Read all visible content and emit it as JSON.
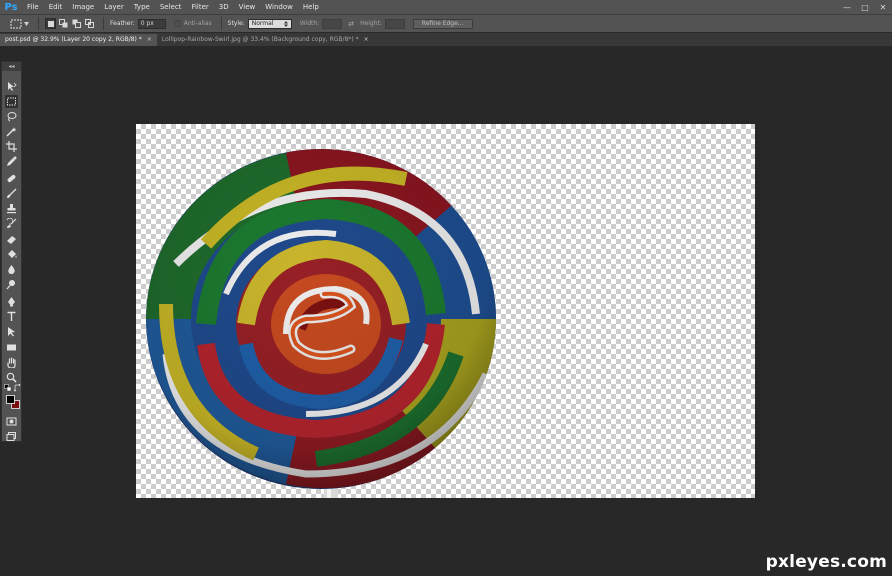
{
  "app": {
    "logo": "Ps"
  },
  "menu": [
    "File",
    "Edit",
    "Image",
    "Layer",
    "Type",
    "Select",
    "Filter",
    "3D",
    "View",
    "Window",
    "Help"
  ],
  "window_controls": {
    "minimize": "—",
    "maximize": "□",
    "close": "✕"
  },
  "options": {
    "feather_label": "Feather:",
    "feather_value": "0 px",
    "antialias_label": "Anti-alias",
    "style_label": "Style:",
    "style_value": "Normal",
    "width_label": "Width:",
    "swap_glyph": "⇄",
    "height_label": "Height:",
    "refine_edge": "Refine Edge..."
  },
  "tabs": [
    {
      "title": "post.psd @ 32.9% (Layer 20 copy 2, RGB/8) *",
      "active": true
    },
    {
      "title": "Lollipop-Rainbow-Swirl.jpg @ 33.4% (Background copy, RGB/8*) *",
      "active": false
    }
  ],
  "tab_close": "×",
  "toolbox": {
    "grip": "◂◂",
    "tools": [
      "move-tool",
      "marquee-tool",
      "lasso-tool",
      "quick-selection-tool",
      "crop-tool",
      "eyedropper-tool",
      "healing-brush-tool",
      "brush-tool",
      "clone-stamp-tool",
      "history-brush-tool",
      "eraser-tool",
      "paint-bucket-tool",
      "blur-tool",
      "dodge-tool",
      "pen-tool",
      "type-tool",
      "path-selection-tool",
      "rectangle-tool",
      "hand-tool",
      "zoom-tool"
    ],
    "foreground_color": "#000000",
    "background_color": "#7a1010"
  },
  "canvas": {
    "transparent_pattern": "checkerboard"
  },
  "watermark": "pxleyes.com"
}
